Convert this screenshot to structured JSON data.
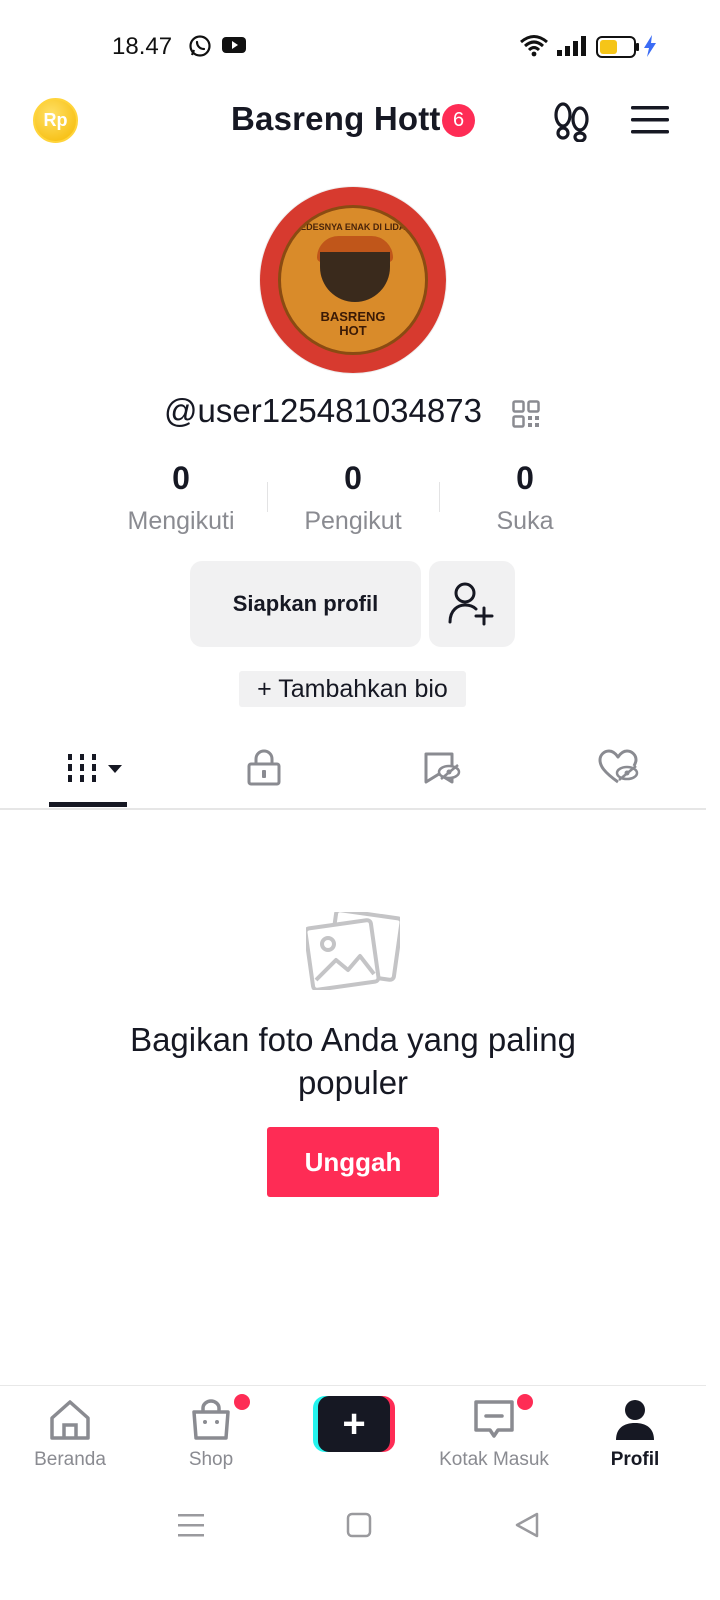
{
  "status_bar": {
    "time": "18.47",
    "icons": [
      "whatsapp-icon",
      "youtube-icon",
      "wifi-icon",
      "signal-icon",
      "battery-icon",
      "charging-icon"
    ]
  },
  "header": {
    "coin_label": "Rp",
    "title": "Basreng Hott",
    "badge_count": "6"
  },
  "profile": {
    "avatar_text_arc": "PEDESNYA ENAK DI LIDAH",
    "avatar_text_name_line1": "BASRENG",
    "avatar_text_name_line2": "HOT",
    "username": "@user125481034873"
  },
  "stats": [
    {
      "value": "0",
      "label": "Mengikuti"
    },
    {
      "value": "0",
      "label": "Pengikut"
    },
    {
      "value": "0",
      "label": "Suka"
    }
  ],
  "actions": {
    "setup_profile": "Siapkan profil",
    "add_bio": "+ Tambahkan bio"
  },
  "tabs": [
    "videos-grid-icon",
    "lock-icon",
    "favorites-hidden-icon",
    "liked-hidden-icon"
  ],
  "empty_state": {
    "title": "Bagikan foto Anda yang paling populer",
    "button": "Unggah"
  },
  "bottom_nav": [
    {
      "label": "Beranda",
      "icon": "home-icon",
      "active": false
    },
    {
      "label": "Shop",
      "icon": "shop-bag-icon",
      "active": false,
      "dot": true
    },
    {
      "label": "",
      "icon": "create-plus-icon",
      "active": false
    },
    {
      "label": "Kotak Masuk",
      "icon": "inbox-icon",
      "active": false,
      "dot": true
    },
    {
      "label": "Profil",
      "icon": "profile-icon",
      "active": true
    }
  ],
  "colors": {
    "accent": "#fe2c55",
    "text": "#161823",
    "muted": "#8a8b91",
    "button_bg": "#f1f1f2"
  }
}
